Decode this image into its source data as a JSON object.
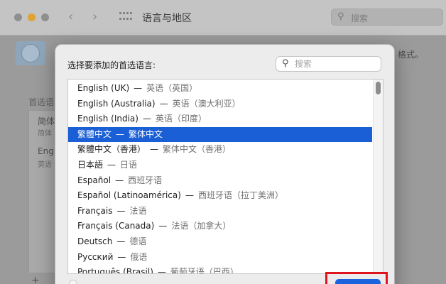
{
  "window": {
    "title": "语言与地区",
    "search_placeholder": "搜索",
    "hint_fragment": "格式。",
    "preferred_label": "首选语",
    "preferred_items": [
      {
        "name": "简体",
        "sub": "简体"
      },
      {
        "name": "Eng",
        "sub": "英语"
      }
    ],
    "add_symbol": "+",
    "back_symbol": "‹",
    "forward_symbol": "›"
  },
  "dialog": {
    "prompt": "选择要添加的首选语言:",
    "search_placeholder": "搜索",
    "selected_index": 3,
    "languages": [
      {
        "native": "English (UK)",
        "local": "英语（英国）"
      },
      {
        "native": "English (Australia)",
        "local": "英语（澳大利亚）"
      },
      {
        "native": "English (India)",
        "local": "英语（印度）"
      },
      {
        "native": "繁體中文",
        "local": "繁体中文"
      },
      {
        "native": "繁體中文（香港）",
        "local": "繁体中文（香港）"
      },
      {
        "native": "日本語",
        "local": "日语"
      },
      {
        "native": "Español",
        "local": "西班牙语"
      },
      {
        "native": "Español (Latinoamérica)",
        "local": "西班牙语（拉丁美洲）"
      },
      {
        "native": "Français",
        "local": "法语"
      },
      {
        "native": "Français (Canada)",
        "local": "法语（加拿大）"
      },
      {
        "native": "Deutsch",
        "local": "德语"
      },
      {
        "native": "Русский",
        "local": "俄语"
      },
      {
        "native": "Português (Brasil)",
        "local": "葡萄牙语（巴西）"
      }
    ]
  },
  "colors": {
    "selection": "#1a5fd6",
    "highlight_box": "#e0141c",
    "primary_button": "#1b63de",
    "traffic_yellow": "#e0a431"
  }
}
